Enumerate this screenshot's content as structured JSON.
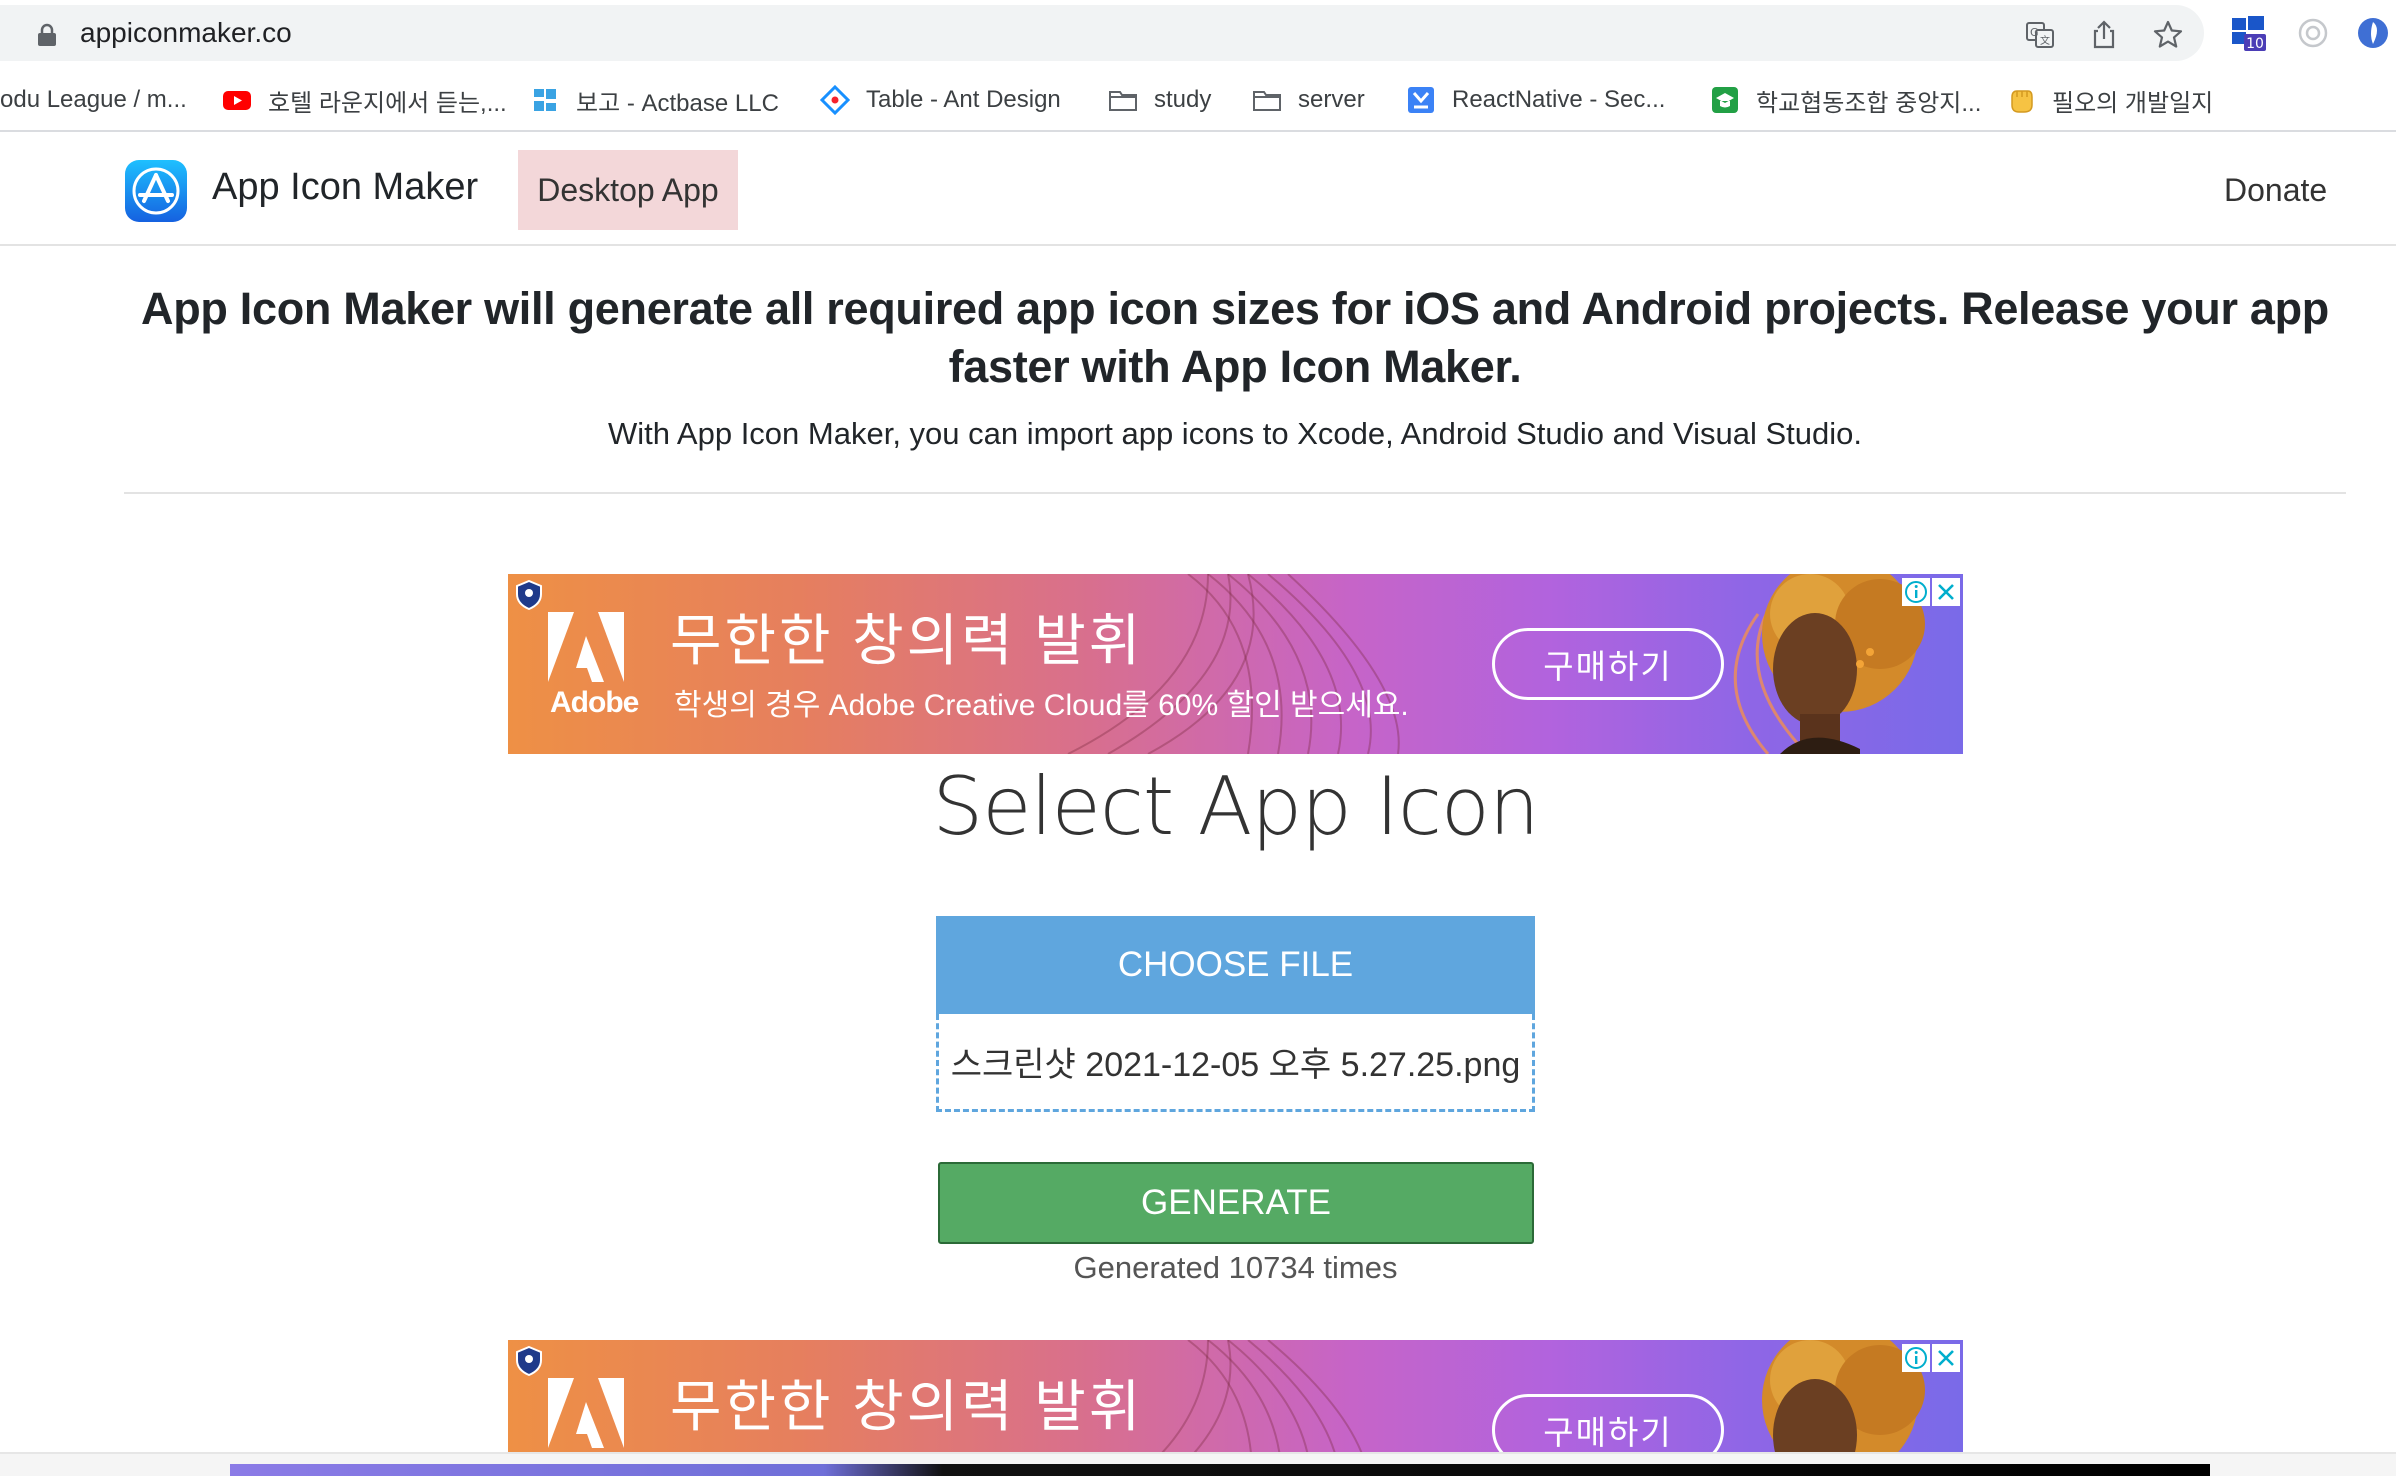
{
  "browser": {
    "url": "appiconmaker.co",
    "extension_badge": "10",
    "bookmarks": [
      {
        "label": "odu League / m..."
      },
      {
        "label": "호텔 라운지에서 듣는,..."
      },
      {
        "label": "보고 - Actbase LLC"
      },
      {
        "label": "Table - Ant Design"
      },
      {
        "label": "study"
      },
      {
        "label": "server"
      },
      {
        "label": "ReactNative - Sec..."
      },
      {
        "label": "학교협동조합 중앙지..."
      },
      {
        "label": "필오의 개발일지"
      }
    ]
  },
  "navbar": {
    "brand": "App Icon Maker",
    "desktop_app": "Desktop App",
    "donate": "Donate"
  },
  "hero": {
    "title": "App Icon Maker will generate all required app icon sizes for iOS and Android projects. Release your app faster with App Icon Maker.",
    "subtitle": "With App Icon Maker, you can import app icons to Xcode, Android Studio and Visual Studio."
  },
  "ad": {
    "brand": "Adobe",
    "headline": "무한한 창의력 발휘",
    "body": "학생의 경우 Adobe Creative Cloud를 60% 할인 받으세요.",
    "cta": "구매하기"
  },
  "tool": {
    "title": "Select App Icon",
    "choose_file": "CHOOSE FILE",
    "file_name": "스크린샷 2021-12-05 오후 5.27.25.png",
    "generate": "GENERATE",
    "generated_count": "Generated 10734 times"
  },
  "colors": {
    "choose_button": "#5fa6de",
    "generate_button": "#55aa64",
    "desktop_app_highlight": "#f3d7d9"
  }
}
